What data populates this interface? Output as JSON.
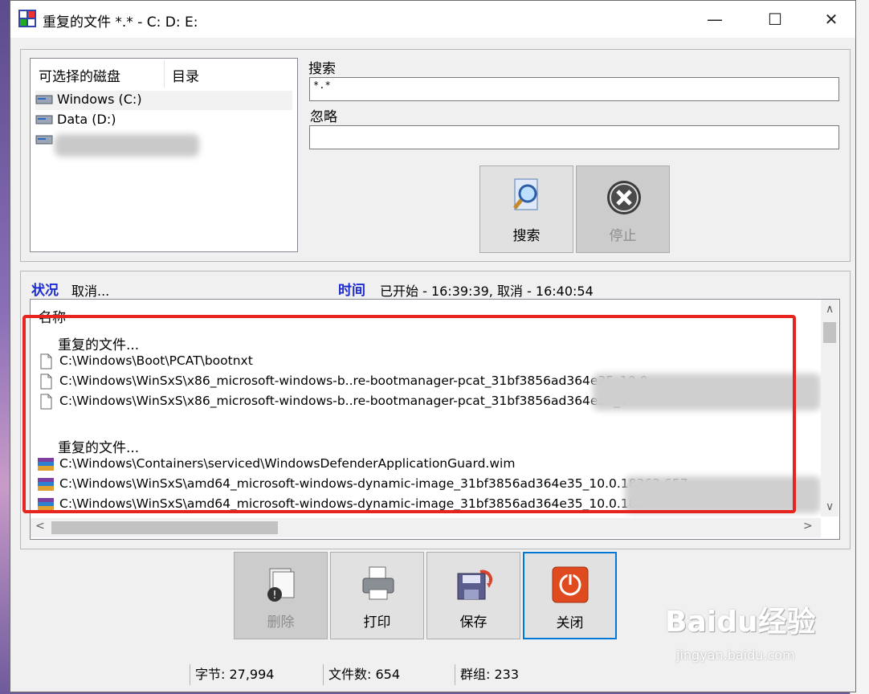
{
  "window": {
    "title": "重复的文件 *.* - C: D: E:"
  },
  "drives": {
    "col_drive": "可选择的磁盘",
    "col_dir": "目录",
    "items": [
      {
        "label": "Windows (C:)"
      },
      {
        "label": "Data (D:)"
      }
    ]
  },
  "search": {
    "label": "搜索",
    "value": "*.*"
  },
  "ignore": {
    "label": "忽略",
    "value": ""
  },
  "buttons": {
    "search": "搜索",
    "stop": "停止",
    "delete": "删除",
    "print": "打印",
    "save": "保存",
    "close": "关闭"
  },
  "status": {
    "label": "状况",
    "value": "取消...",
    "time_label": "时间",
    "time_value": "已开始 - 16:39:39, 取消 - 16:40:54"
  },
  "results": {
    "header": "名称",
    "groups": [
      {
        "title": "重复的文件...",
        "files": [
          "C:\\Windows\\Boot\\PCAT\\bootnxt",
          "C:\\Windows\\WinSxS\\x86_microsoft-windows-b..re-bootmanager-pcat_31bf3856ad364e35_10.0",
          "C:\\Windows\\WinSxS\\x86_microsoft-windows-b..re-bootmanager-pcat_31bf3856ad364e35_10"
        ]
      },
      {
        "title": "重复的文件...",
        "files": [
          "C:\\Windows\\Containers\\serviced\\WindowsDefenderApplicationGuard.wim",
          "C:\\Windows\\WinSxS\\amd64_microsoft-windows-dynamic-image_31bf3856ad364e35_10.0.18362.657",
          "C:\\Windows\\WinSxS\\amd64_microsoft-windows-dynamic-image_31bf3856ad364e35_10.0.18362"
        ]
      }
    ]
  },
  "statusbar": {
    "bytes": "字节: 27,994",
    "files": "文件数: 654",
    "groups": "群组: 233"
  },
  "watermark": {
    "brand": "Baidu经验",
    "url": "jingyan.baidu.com"
  },
  "colors": {
    "highlight": "#e8241e",
    "status_label": "#1c2bd0",
    "focus": "#0078d7"
  }
}
